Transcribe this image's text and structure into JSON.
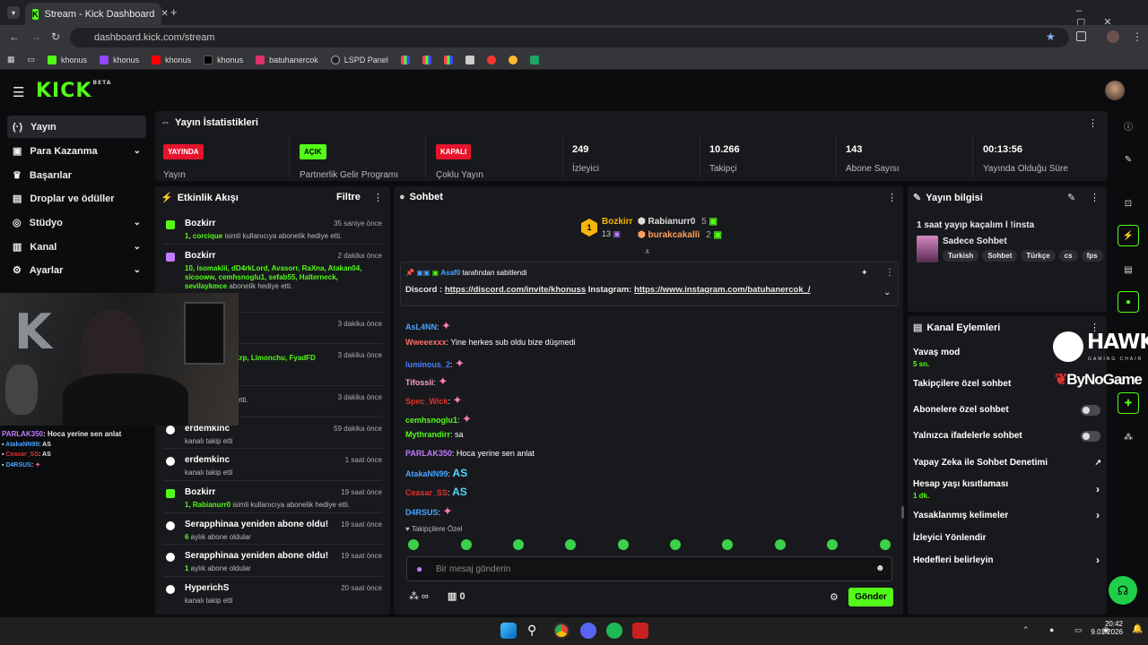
{
  "browser": {
    "tab_title": "Stream - Kick Dashboard",
    "url": "dashboard.kick.com/stream",
    "bookmarks": [
      "khonus",
      "khonus",
      "khonus",
      "khonus",
      "batuhanercok",
      "LSPD Panel"
    ]
  },
  "sidebar": {
    "items": [
      "Yayın",
      "Para Kazanma",
      "Başarılar",
      "Droplar ve ödüller",
      "Stüdyo",
      "Kanal",
      "Ayarlar"
    ]
  },
  "stats": {
    "title": "Yayın İstatistikleri",
    "items": [
      {
        "badge": "YAYINDA",
        "badge_color": "#e5142c",
        "label": "Yayın"
      },
      {
        "badge": "AÇIK",
        "badge_color": "#53fc18",
        "label": "Partnerlik Gelir Programı"
      },
      {
        "badge": "KAPALI",
        "badge_color": "#e5142c",
        "label": "Çoklu Yayın"
      },
      {
        "value": "249",
        "label": "İzleyici"
      },
      {
        "value": "10.266",
        "label": "Takipçi"
      },
      {
        "value": "143",
        "label": "Abone Sayısı"
      },
      {
        "value": "00:13:56",
        "label": "Yayında Olduğu Süre"
      }
    ]
  },
  "events": {
    "title": "Etkinlik Akışı",
    "filter": "Filtre",
    "items": [
      {
        "user": "Bozkirr",
        "time": "35 saniye önce",
        "pre": "1,",
        "hl": "corcique",
        "post": " isimli kullanıcıya abonelik hediye etti."
      },
      {
        "user": "Bozkirr",
        "time": "2 dakika önce",
        "pre": "10,",
        "hl": "isomakiii, dD4rkLord, Avasorr, RaXna, Atakan04, sicooww, cemhsnoglu1, sefab55, Halterneck, sevilaykmce",
        "post": " abonelik hediye etti."
      },
      {
        "user": "…g",
        "time": "3 dakika önce",
        "pre": "",
        "hl": "",
        "post": ""
      },
      {
        "user": "",
        "time": "3 dakika önce",
        "pre": "",
        "hl": "zamaayri, eneskrp, Limonchu, FyadFD",
        "post": ""
      },
      {
        "user": "",
        "time": "3 dakika önce",
        "pre": "",
        "hl": "",
        "post": " abonelik hediye etti."
      },
      {
        "user": "erdemkinc",
        "time": "59 dakika önce",
        "pre": "",
        "hl": "",
        "post": "kanalı takip etti"
      },
      {
        "user": "erdemkinc",
        "time": "1 saat önce",
        "pre": "",
        "hl": "",
        "post": "kanalı takip etti"
      },
      {
        "user": "Bozkirr",
        "time": "19 saat önce",
        "pre": "1,",
        "hl": "Rabianurr0",
        "post": " isimli kullanıcıya abonelik hediye etti."
      },
      {
        "user": "Serapphinaa yeniden abone oldu!",
        "time": "19 saat önce",
        "pre": "",
        "hl": "6",
        "post": " aylık abone oldular"
      },
      {
        "user": "Serapphinaa yeniden abone oldu!",
        "time": "19 saat önce",
        "pre": "",
        "hl": "1",
        "post": " aylık abone oldular"
      },
      {
        "user": "HyperichS",
        "time": "20 saat önce",
        "pre": "",
        "hl": "",
        "post": "kanalı takip etti"
      }
    ]
  },
  "overlay_chat": [
    {
      "user": "PARLAK350",
      "color": "#c07cff",
      "msg": ": Hoca yerine sen anlat"
    },
    {
      "user": "AtakaNN99",
      "color": "#4aa3ff",
      "msg": ": AS"
    },
    {
      "user": "Ceasar_SS",
      "color": "#e03030",
      "msg": ": AS"
    },
    {
      "user": "D4RSUS",
      "color": "#4aa3ff",
      "msg": ":"
    }
  ],
  "chat": {
    "title": "Sohbet",
    "leaders": {
      "first": "Bozkirr",
      "first_count": "13",
      "second": "Rabianurr0",
      "second_count": "5",
      "third": "burakcakalli",
      "third_count": "2"
    },
    "pinned_by": "Asaf0",
    "pinned_suffix": "tarafından sabitlendi",
    "pinned_label": "Discord :",
    "pinned_link1": "https://discord.com/invite/khonuss",
    "pinned_mid": " Instagram:",
    "pinned_link2": "https://www.instagram.com/batuhanercok_/",
    "messages": [
      {
        "user": "AsL4NN",
        "color": "#4aa3ff",
        "text": ""
      },
      {
        "user": "Wweeexxx",
        "color": "#ff6b6b",
        "text": "Yine herkes sub oldu bize düşmedi"
      },
      {
        "user": "luminous_2",
        "color": "#4a7dff",
        "text": ""
      },
      {
        "user": "Tifossii",
        "color": "#ff9ecb",
        "text": ""
      },
      {
        "user": "Spec_Wick",
        "color": "#e03030",
        "text": ""
      },
      {
        "user": "cemhsnoglu1",
        "color": "#53fc18",
        "text": ""
      },
      {
        "user": "Mythrandirr",
        "color": "#53fc18",
        "text": "sa"
      },
      {
        "user": "PARLAK350",
        "color": "#c07cff",
        "text": "Hoca yerine sen anlat"
      },
      {
        "user": "AtakaNN99",
        "color": "#4aa3ff",
        "text": "AS"
      },
      {
        "user": "Ceasar_SS",
        "color": "#e03030",
        "text": "AS"
      },
      {
        "user": "D4RSUS",
        "color": "#4aa3ff",
        "text": ""
      }
    ],
    "followers_only": "Takipçilere Özel",
    "placeholder": "Bir mesaj gönderin",
    "count": "0",
    "send": "Gönder"
  },
  "stream_info": {
    "title": "Yayın bilgisi",
    "stream_title": "1 saat yayıp kaçalım l !insta",
    "category": "Sadece Sohbet",
    "tags": [
      "Turkish",
      "Sohbet",
      "Türkçe",
      "cs",
      "fps"
    ]
  },
  "channel_actions": {
    "title": "Kanal Eylemleri",
    "slow_mode": "Yavaş mod",
    "slow_value": "5 sn.",
    "followers": "Takipçilere özel sohbet",
    "subs": "Abonelere özel sohbet",
    "emotes": "Yalnızca ifadelerle sohbet",
    "ai": "Yapay Zeka ile Sohbet Denetimi",
    "age": "Hesap yaşı kısıtlaması",
    "age_value": "1 dk.",
    "banned": "Yasaklanmış kelimeler",
    "redirect": "İzleyici Yönlendir",
    "goals": "Hedefleri belirleyin"
  },
  "sponsor": {
    "hawk": "HAWK",
    "hawk_sub": "GAMING CHAIR",
    "bynogame": "ByNoGame"
  },
  "taskbar": {
    "time": "20:42",
    "date": "9.01.2026"
  }
}
